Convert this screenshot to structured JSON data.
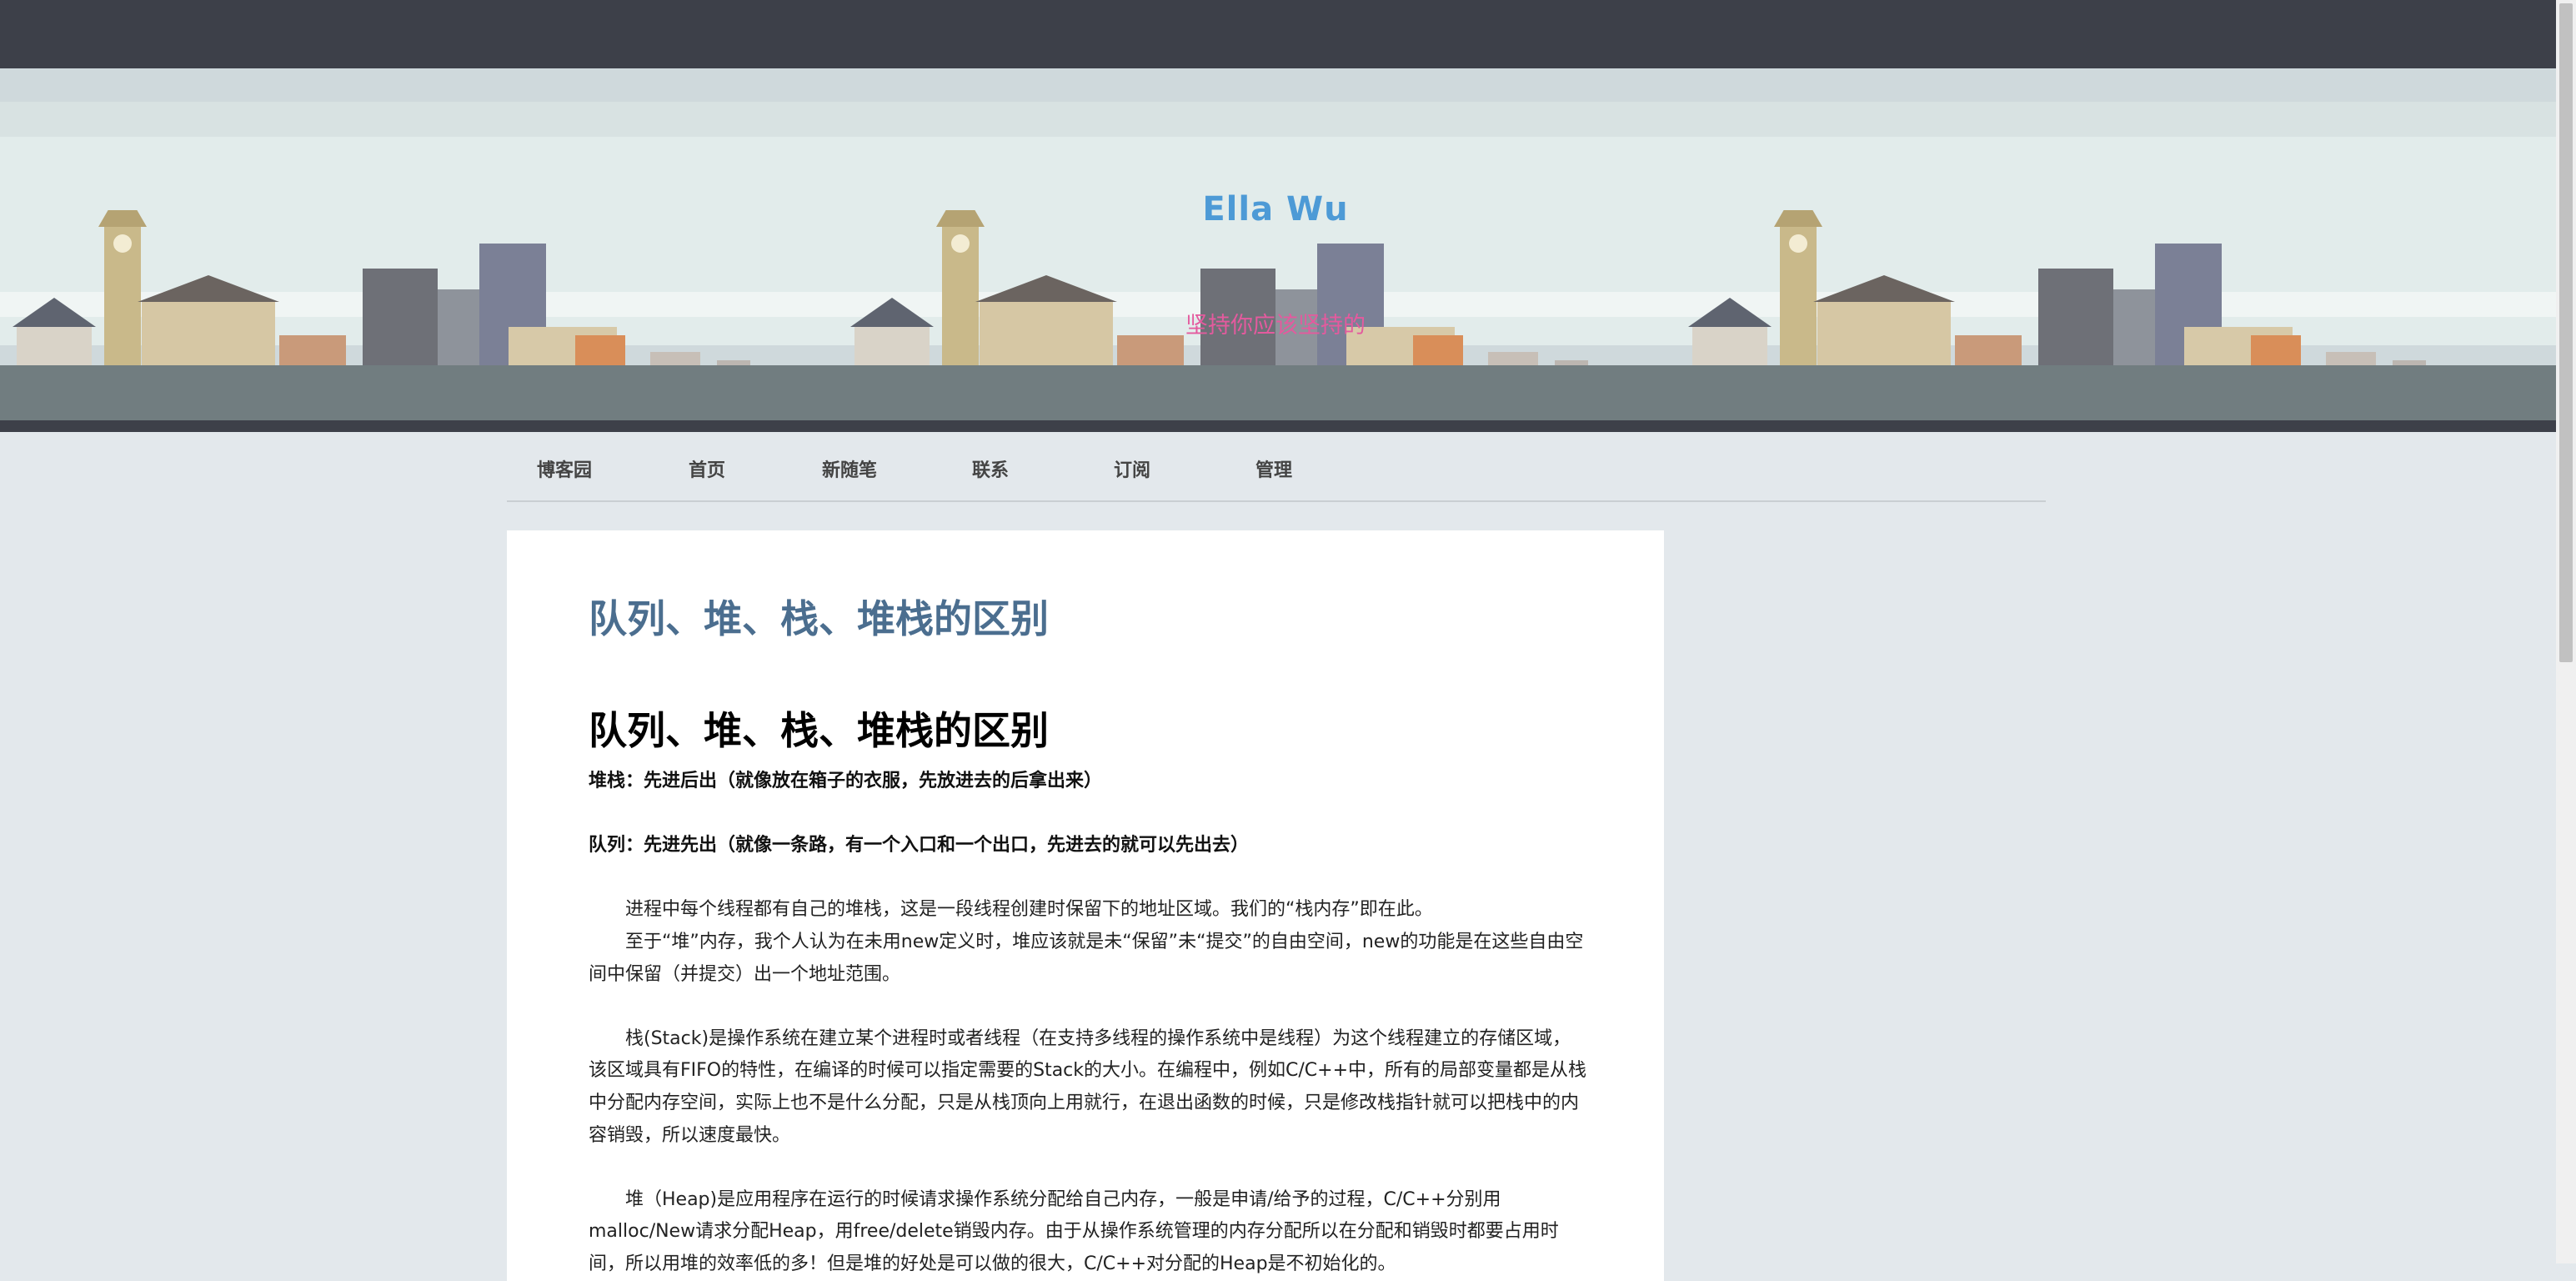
{
  "header": {
    "site_title": "Ella Wu",
    "site_subtitle": "坚持你应该坚持的"
  },
  "nav": {
    "items": [
      "博客园",
      "首页",
      "新随笔",
      "联系",
      "订阅",
      "管理"
    ]
  },
  "post": {
    "title": "队列、堆、栈、堆栈的区别",
    "heading": "队列、堆、栈、堆栈的区别",
    "stack_def": "堆栈：先进后出（就像放在箱子的衣服，先放进去的后拿出来）",
    "queue_def": "队列：先进先出（就像一条路，有一个入口和一个出口，先进去的就可以先出去）",
    "para1_line1": "进程中每个线程都有自己的堆栈，这是一段线程创建时保留下的地址区域。我们的“栈内存”即在此。",
    "para1_line2": "至于“堆”内存，我个人认为在未用new定义时，堆应该就是未“保留”未“提交”的自由空间，new的功能是在这些自由空间中保留（并提交）出一个地址范围。",
    "para2": "栈(Stack)是操作系统在建立某个进程时或者线程（在支持多线程的操作系统中是线程）为这个线程建立的存储区域，该区域具有FIFO的特性，在编译的时候可以指定需要的Stack的大小。在编程中，例如C/C++中，所有的局部变量都是从栈中分配内存空间，实际上也不是什么分配，只是从栈顶向上用就行，在退出函数的时候，只是修改栈指针就可以把栈中的内容销毁，所以速度最快。",
    "para3": "堆（Heap)是应用程序在运行的时候请求操作系统分配给自己内存，一般是申请/给予的过程，C/C++分别用malloc/New请求分配Heap，用free/delete销毁内存。由于从操作系统管理的内存分配所以在分配和销毁时都要占用时间，所以用堆的效率低的多！但是堆的好处是可以做的很大，C/C++对分配的Heap是不初始化的。"
  }
}
